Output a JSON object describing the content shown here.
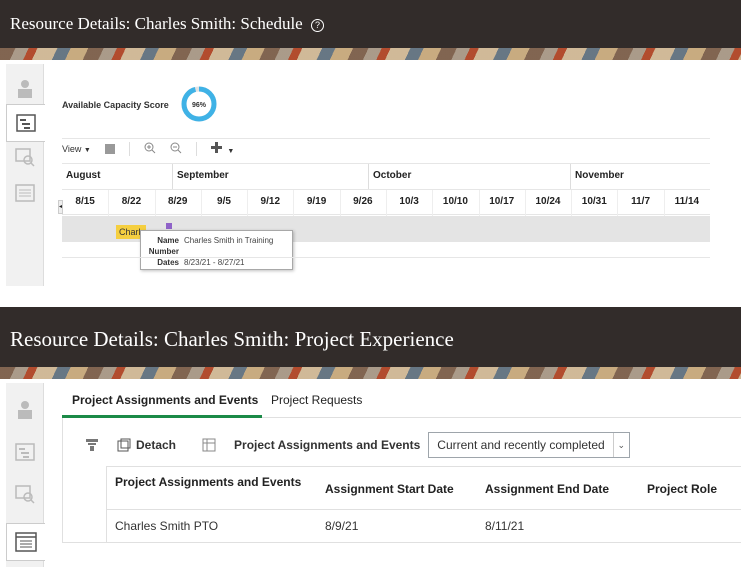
{
  "schedule": {
    "title": "Resource Details: Charles Smith: Schedule",
    "help_glyph": "?",
    "capacity_label": "Available Capacity Score",
    "capacity_value": "96%",
    "capacity_fraction": 0.96,
    "toolbar": {
      "view_label": "View",
      "view_caret": "▼",
      "add_caret": "▼"
    },
    "months": [
      "August",
      "September",
      "October",
      "November"
    ],
    "weeks": [
      "8/15",
      "8/22",
      "8/29",
      "9/5",
      "9/12",
      "9/19",
      "9/26",
      "10/3",
      "10/10",
      "10/17",
      "10/24",
      "10/31",
      "11/7",
      "11/14"
    ],
    "event_bar_label": "Charles Smith in Training",
    "tooltip": {
      "name_key": "Name",
      "name_value": "Charles Smith in Training",
      "number_key": "Number",
      "dates_key": "Dates",
      "dates_value": "8/23/21 - 8/27/21"
    }
  },
  "experience": {
    "title": "Resource Details: Charles Smith: Project Experience",
    "tabs": [
      "Project Assignments and Events",
      "Project Requests"
    ],
    "toolbar": {
      "detach_label": "Detach",
      "filter_label": "Project Assignments and Events",
      "select_value": "Current and recently completed"
    },
    "columns": [
      "Project Assignments and Events",
      "Assignment Start Date",
      "Assignment End Date",
      "Project Role"
    ],
    "rows": [
      {
        "event": "Charles Smith PTO",
        "start": "8/9/21",
        "end": "8/11/21",
        "role": ""
      }
    ]
  },
  "colors": {
    "header_bg": "#322c2a",
    "donut": "#3fb2e6",
    "bar": "#f5cf40",
    "tab_underline": "#1b8a47"
  }
}
